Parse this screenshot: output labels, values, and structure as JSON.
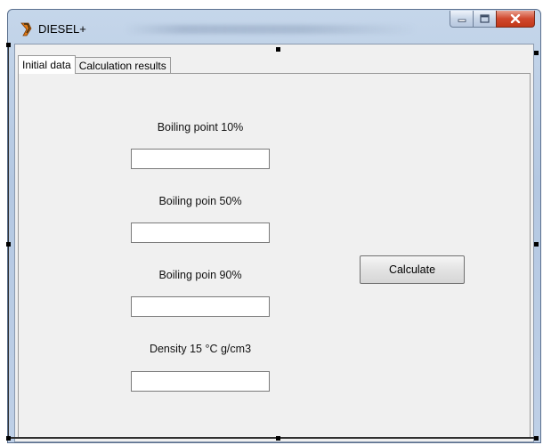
{
  "window": {
    "title": "DIESEL+",
    "app_icon": "diesel-app-icon"
  },
  "caption_buttons": {
    "minimize_icon": "minimize-icon",
    "maximize_icon": "maximize-icon",
    "close_icon": "close-icon"
  },
  "tabs": [
    {
      "label": "Initial data",
      "active": true
    },
    {
      "label": "Calculation results",
      "active": false
    }
  ],
  "fields": [
    {
      "label": "Boiling point 10%",
      "value": ""
    },
    {
      "label": "Boiling poin 50%",
      "value": ""
    },
    {
      "label": "Boiling poin 90%",
      "value": ""
    },
    {
      "label": "Density 15 °C g/cm3",
      "value": ""
    }
  ],
  "calculate_label": "Calculate",
  "colors": {
    "close_button": "#c94a2e",
    "titlebar": "#bfd0e7",
    "client_bg": "#f0f0f0"
  }
}
